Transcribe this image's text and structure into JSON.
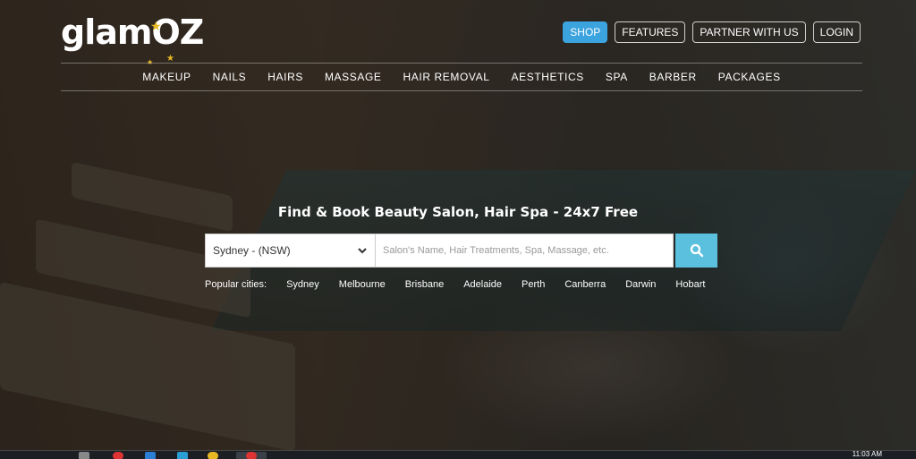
{
  "brand": {
    "logo_text_main": "glam",
    "logo_text_accent": "OZ"
  },
  "top_buttons": [
    {
      "label": "SHOP",
      "primary": true
    },
    {
      "label": "FEATURES",
      "primary": false
    },
    {
      "label": "PARTNER WITH US",
      "primary": false
    },
    {
      "label": "LOGIN",
      "primary": false
    }
  ],
  "nav": [
    "MAKEUP",
    "NAILS",
    "HAIRS",
    "MASSAGE",
    "HAIR REMOVAL",
    "AESTHETICS",
    "SPA",
    "BARBER",
    "PACKAGES"
  ],
  "hero": {
    "headline": "Find & Book Beauty Salon, Hair Spa - 24x7 Free",
    "city_selected": "Sydney - (NSW)",
    "search_placeholder": "Salon's Name, Hair Treatments, Spa, Massage, etc.",
    "popular_label": "Popular cities:",
    "popular_cities": [
      "Sydney",
      "Melbourne",
      "Brisbane",
      "Adelaide",
      "Perth",
      "Canberra",
      "Darwin",
      "Hobart"
    ]
  },
  "taskbar": {
    "clock": "11:03 AM"
  },
  "colors": {
    "primary_button": "#3ba3dd",
    "search_button": "#5bc0de",
    "star": "#e8b923"
  }
}
